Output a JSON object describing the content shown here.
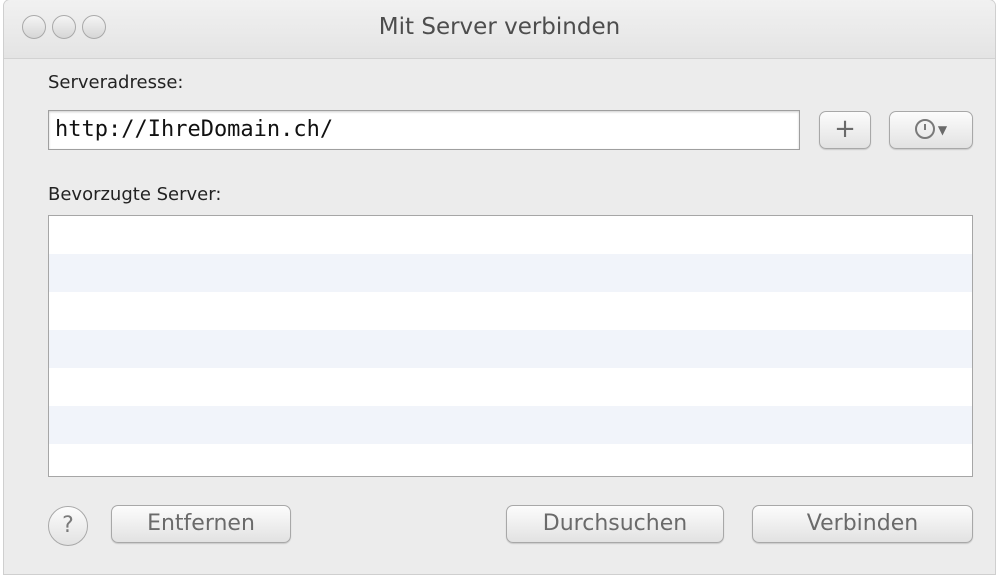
{
  "window": {
    "title": "Mit Server verbinden"
  },
  "address": {
    "label": "Serveradresse:",
    "value": "http://IhreDomain.ch/"
  },
  "favorites": {
    "label": "Bevorzugte Server:",
    "items": []
  },
  "buttons": {
    "add": "+",
    "help": "?",
    "remove": "Entfernen",
    "browse": "Durchsuchen",
    "connect": "Verbinden"
  }
}
